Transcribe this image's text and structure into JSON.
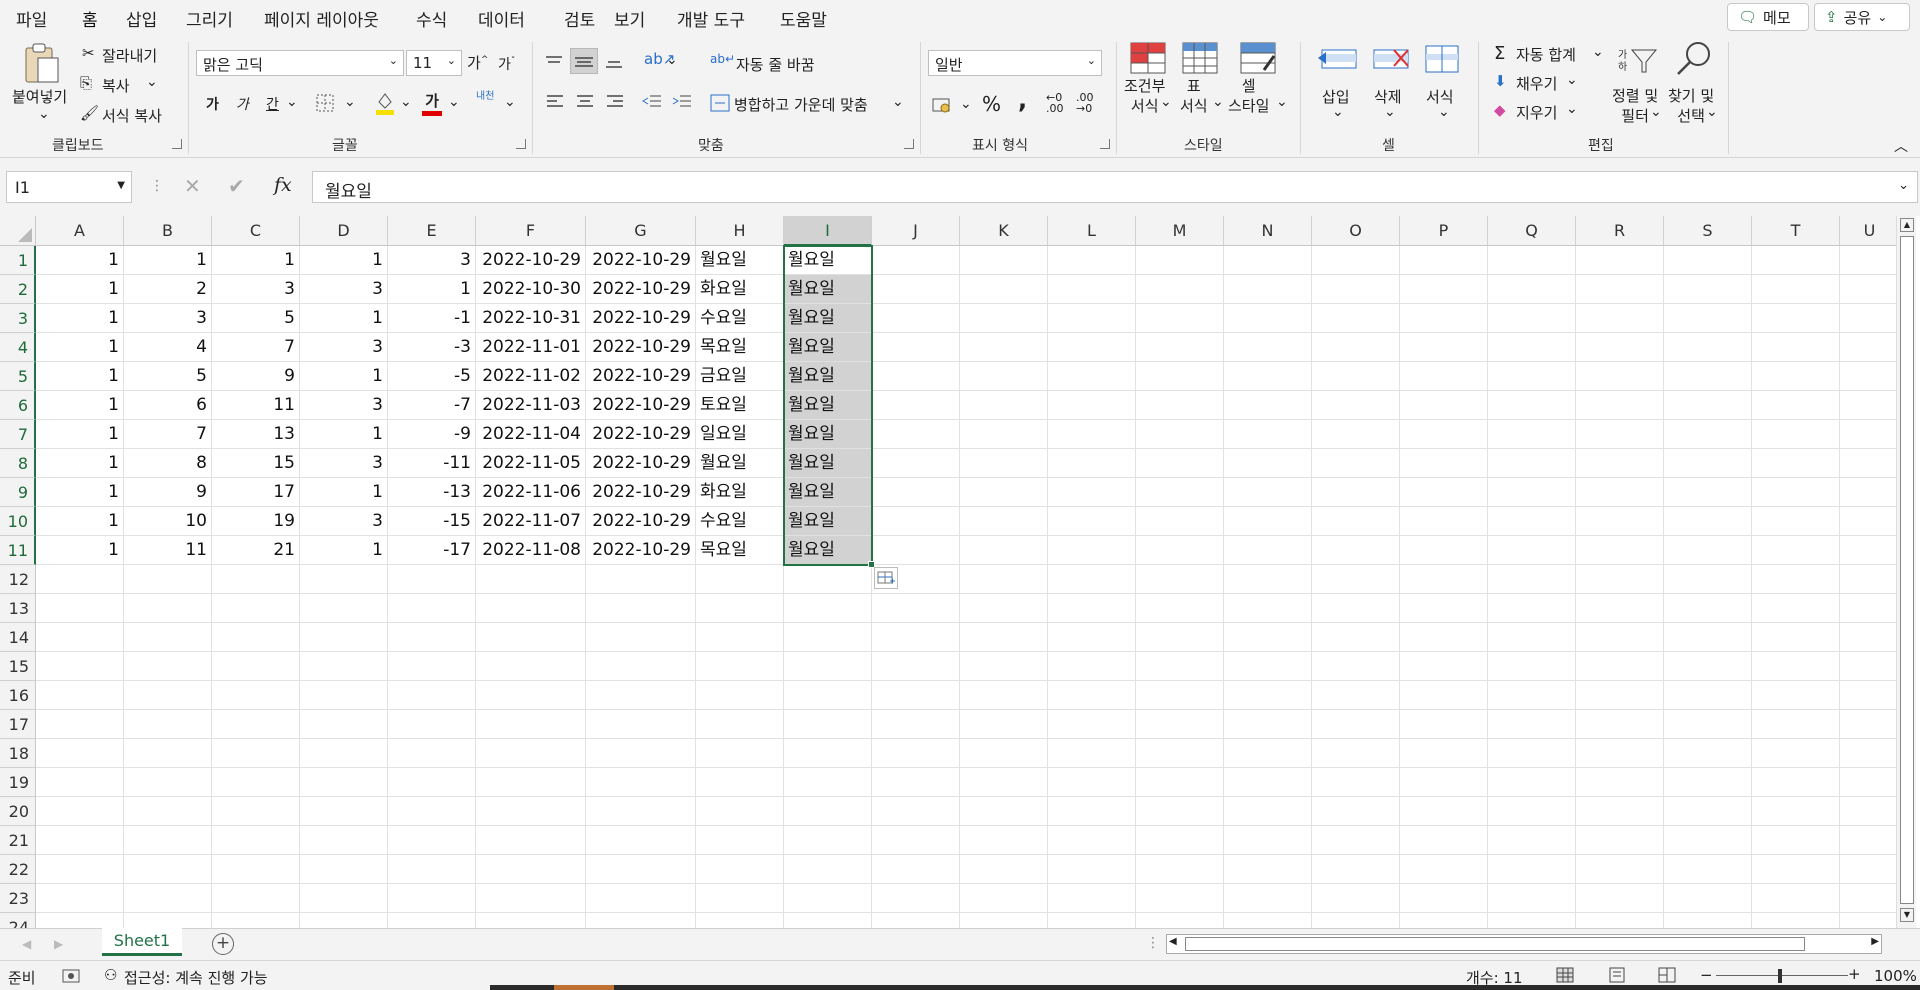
{
  "menu": {
    "items": [
      "파일",
      "홈",
      "삽입",
      "그리기",
      "페이지 레이아웃",
      "수식",
      "데이터",
      "검토",
      "보기",
      "개발 도구",
      "도움말"
    ],
    "active": "홈",
    "memo_label": "메모",
    "share_label": "공유"
  },
  "ribbon": {
    "clipboard": {
      "paste": "붙여넣기",
      "cut": "잘라내기",
      "copy": "복사",
      "format_painter": "서식 복사",
      "label": "클립보드"
    },
    "font": {
      "name": "맑은 고딕",
      "size": "11",
      "label": "글꼴",
      "grow": "가",
      "shrink": "가",
      "bold": "가",
      "italic": "가",
      "underline": "간",
      "phonetic": "내천"
    },
    "alignment": {
      "wrap": "자동 줄 바꿈",
      "merge": "병합하고 가운데 맞춤",
      "label": "맞춤"
    },
    "number": {
      "format": "일반",
      "percent": "%",
      "comma": ",",
      "label": "표시 형식"
    },
    "styles": {
      "conditional": "조건부\n서식",
      "table": "표\n서식",
      "cell_style": "셀\n스타일",
      "label": "스타일"
    },
    "cells": {
      "insert": "삽입",
      "delete": "삭제",
      "format": "서식",
      "label": "셀"
    },
    "editing": {
      "autosum": "자동 합계",
      "fill": "채우기",
      "clear": "지우기",
      "sort": "정렬 및\n필터",
      "find": "찾기 및\n선택",
      "label": "편집"
    }
  },
  "formula_bar": {
    "name_box": "I1",
    "value": "월요일"
  },
  "sheet": {
    "columns": [
      "A",
      "B",
      "C",
      "D",
      "E",
      "F",
      "G",
      "H",
      "I",
      "J",
      "K",
      "L",
      "M",
      "N",
      "O",
      "P",
      "Q",
      "R",
      "S",
      "T",
      "U"
    ],
    "row_numbers": [
      "1",
      "2",
      "3",
      "4",
      "5",
      "6",
      "7",
      "8",
      "9",
      "10",
      "11",
      "12",
      "13",
      "14",
      "15",
      "16",
      "17",
      "18",
      "19",
      "20",
      "21",
      "22",
      "23",
      "24"
    ],
    "rows": [
      [
        "1",
        "1",
        "1",
        "1",
        "3",
        "2022-10-29",
        "2022-10-29",
        "월요일",
        "월요일"
      ],
      [
        "1",
        "2",
        "3",
        "3",
        "1",
        "2022-10-30",
        "2022-10-29",
        "화요일",
        "월요일"
      ],
      [
        "1",
        "3",
        "5",
        "1",
        "-1",
        "2022-10-31",
        "2022-10-29",
        "수요일",
        "월요일"
      ],
      [
        "1",
        "4",
        "7",
        "3",
        "-3",
        "2022-11-01",
        "2022-10-29",
        "목요일",
        "월요일"
      ],
      [
        "1",
        "5",
        "9",
        "1",
        "-5",
        "2022-11-02",
        "2022-10-29",
        "금요일",
        "월요일"
      ],
      [
        "1",
        "6",
        "11",
        "3",
        "-7",
        "2022-11-03",
        "2022-10-29",
        "토요일",
        "월요일"
      ],
      [
        "1",
        "7",
        "13",
        "1",
        "-9",
        "2022-11-04",
        "2022-10-29",
        "일요일",
        "월요일"
      ],
      [
        "1",
        "8",
        "15",
        "3",
        "-11",
        "2022-11-05",
        "2022-10-29",
        "월요일",
        "월요일"
      ],
      [
        "1",
        "9",
        "17",
        "1",
        "-13",
        "2022-11-06",
        "2022-10-29",
        "화요일",
        "월요일"
      ],
      [
        "1",
        "10",
        "19",
        "3",
        "-15",
        "2022-11-07",
        "2022-10-29",
        "수요일",
        "월요일"
      ],
      [
        "1",
        "11",
        "21",
        "1",
        "-17",
        "2022-11-08",
        "2022-10-29",
        "목요일",
        "월요일"
      ]
    ],
    "selected_column": "I"
  },
  "tabs": {
    "sheet": "Sheet1"
  },
  "status": {
    "ready": "준비",
    "accessibility": "접근성: 계속 진행 가능",
    "count": "개수: 11",
    "zoom": "100%"
  },
  "colors": {
    "accent": "#217346",
    "selection": "#d2d2d2"
  }
}
